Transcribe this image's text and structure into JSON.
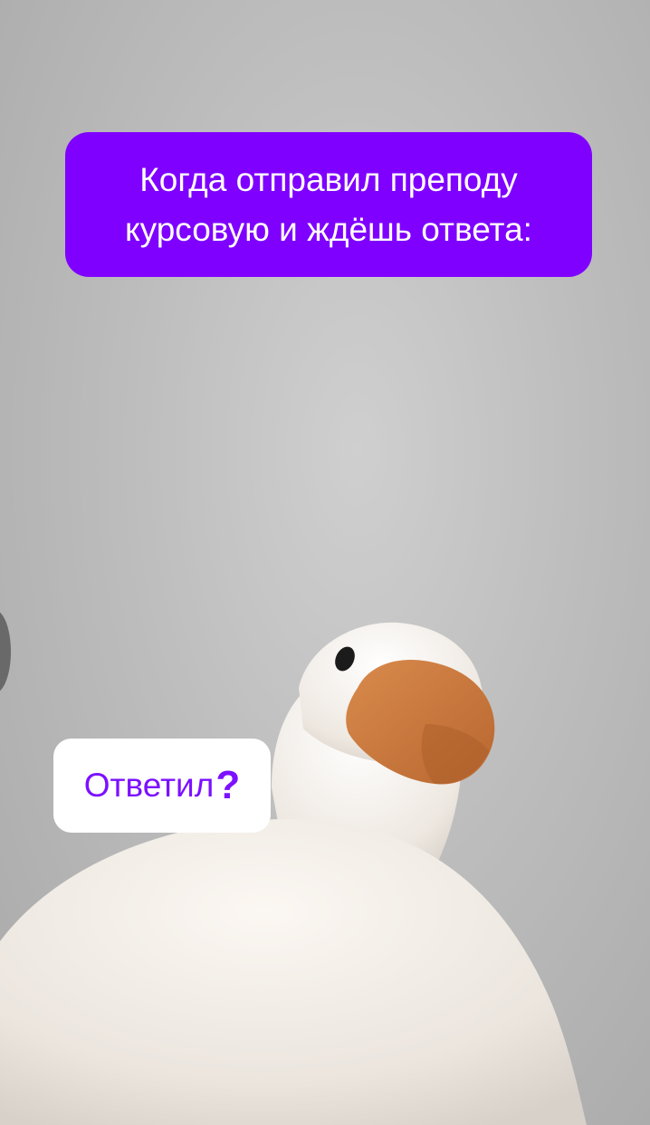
{
  "meme": {
    "caption_line1": "Когда отправил преподу",
    "caption_line2": "курсовую и ждёшь ответа:",
    "reply_text": "Ответил",
    "reply_mark": "?"
  },
  "colors": {
    "caption_bg": "#7f00ff",
    "reply_text": "#7b11ff",
    "beak": "#c5773e"
  },
  "subject": "white-duck"
}
